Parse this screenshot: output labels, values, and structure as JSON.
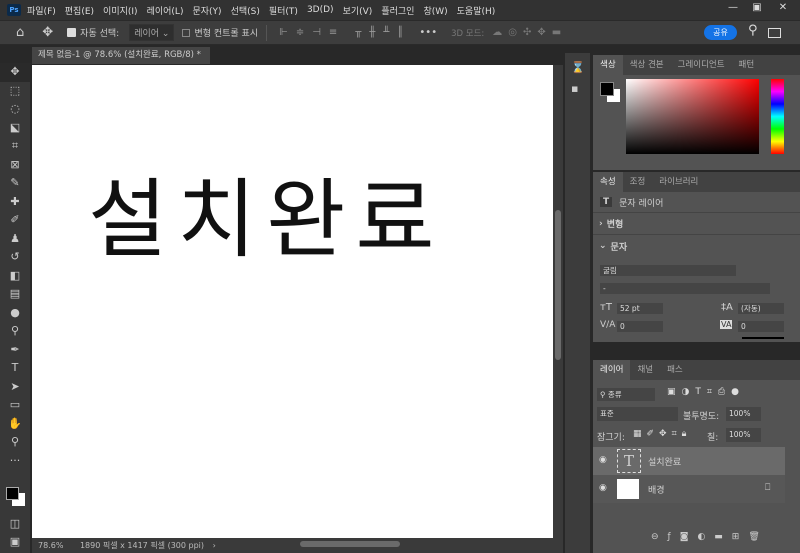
{
  "app": {
    "logo": "Ps"
  },
  "menu": [
    "파일(F)",
    "편집(E)",
    "이미지(I)",
    "레이어(L)",
    "문자(Y)",
    "선택(S)",
    "필터(T)",
    "3D(D)",
    "보기(V)",
    "플러그인",
    "창(W)",
    "도움말(H)"
  ],
  "options": {
    "auto_select_label": "자동 선택:",
    "auto_select_value": "레이어",
    "transform_controls_label": "변형 컨트롤 표시",
    "more": "•••",
    "mode_3d_label": "3D 모드:",
    "share_label": "공유"
  },
  "document": {
    "tab_title": "제목 없음-1 @ 78.6% (설치완료, RGB/8) *",
    "canvas_text": "설치완료",
    "zoom": "78.6%",
    "dimensions": "1890 픽셀 x 1417 픽셀 (300 ppi)"
  },
  "color_panel": {
    "tabs": [
      "색상",
      "색상 견본",
      "그레이디언트",
      "패턴"
    ],
    "foreground": "#000000",
    "background": "#ffffff"
  },
  "properties_panel": {
    "tabs": [
      "속성",
      "조정",
      "라이브러리"
    ],
    "layer_type": "문자 레이어",
    "section_transform": "변형",
    "section_type": "문자",
    "font_family": "굴림",
    "font_style": "-",
    "font_size": "52 pt",
    "leading": "(자동)",
    "kerning": "0",
    "tracking": "0"
  },
  "layers_panel": {
    "tabs": [
      "레이어",
      "채널",
      "패스"
    ],
    "filter": "종류",
    "blend_mode": "표준",
    "opacity_label": "불투명도:",
    "opacity": "100%",
    "lock_label": "잠그기:",
    "fill_label": "칠:",
    "fill": "100%",
    "layers": [
      {
        "name": "설치완료",
        "type": "text",
        "selected": true
      },
      {
        "name": "배경",
        "type": "background",
        "locked": true
      }
    ]
  },
  "colors": {
    "accent": "#1473e6"
  }
}
